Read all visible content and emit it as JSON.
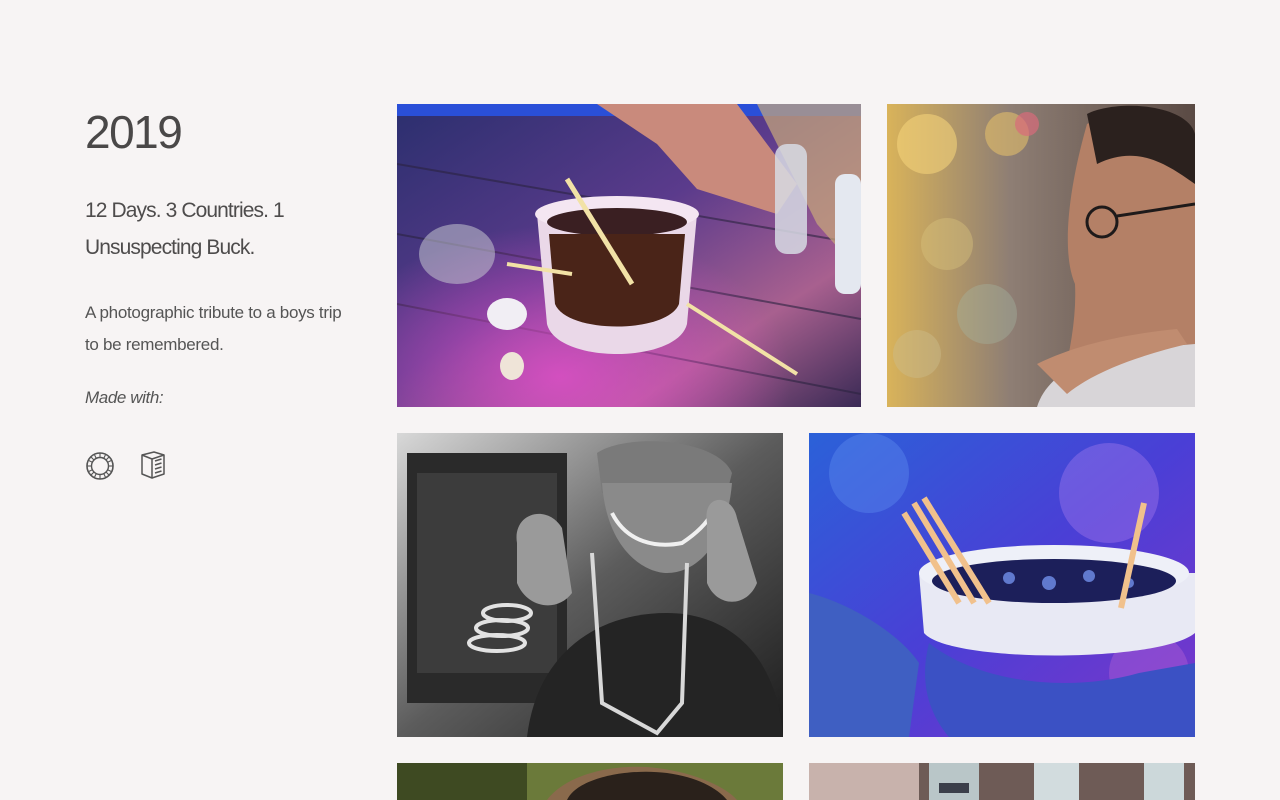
{
  "intro": {
    "year": "2019",
    "tagline": "12 Days. 3 Countries. 1 Unsuspecting Buck.",
    "description": "A photographic tribute to a boys trip to be remembered.",
    "made_with_label": "Made with:"
  },
  "tools": [
    {
      "icon": "vsco-icon"
    },
    {
      "icon": "carrd-icon"
    }
  ],
  "gallery": {
    "photos": [
      {
        "name": "photo-bucket-drink-table"
      },
      {
        "name": "photo-man-glasses-portrait"
      },
      {
        "name": "photo-thumbs-up-bw"
      },
      {
        "name": "photo-blue-bucket-straws"
      },
      {
        "name": "photo-man-portrait-partial"
      },
      {
        "name": "photo-bottles-partial"
      }
    ]
  },
  "colors": {
    "background": "#f7f4f4",
    "text": "#4a4848"
  }
}
